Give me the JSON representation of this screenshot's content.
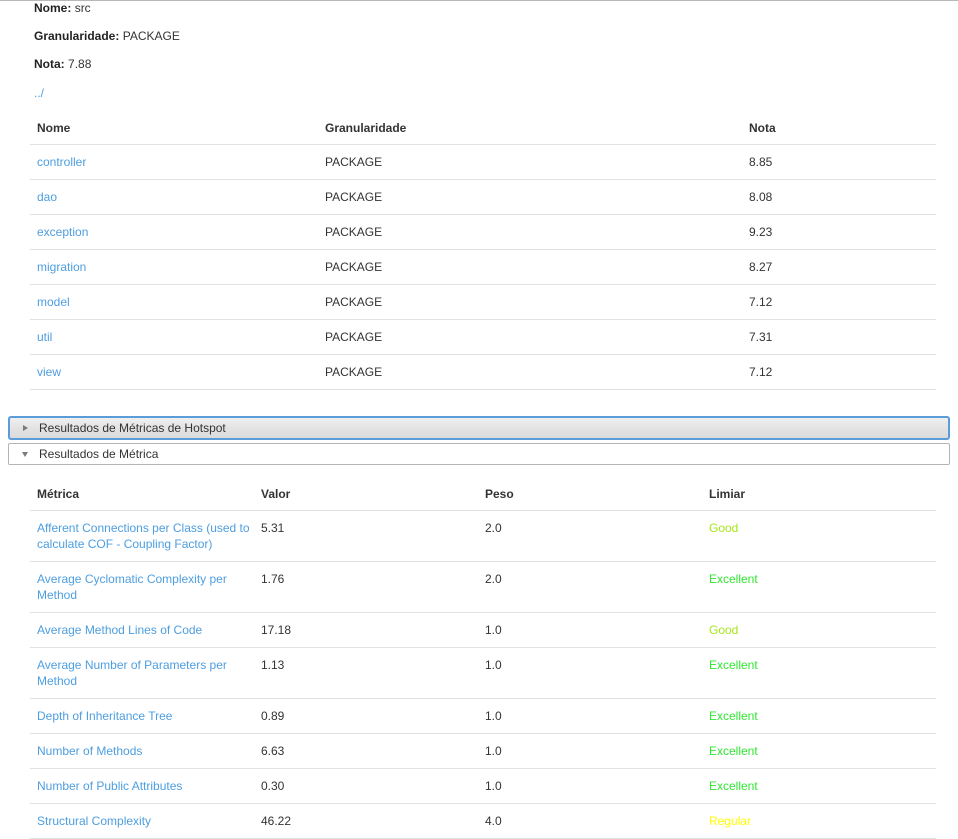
{
  "summary": {
    "nome_label": "Nome:",
    "nome_value": "src",
    "granularidade_label": "Granularidade:",
    "granularidade_value": "PACKAGE",
    "nota_label": "Nota:",
    "nota_value": "7.88",
    "parent_link": "../"
  },
  "files_table": {
    "columns": [
      "Nome",
      "Granularidade",
      "Nota"
    ],
    "rows": [
      {
        "nome": "controller",
        "granularidade": "PACKAGE",
        "nota": "8.85"
      },
      {
        "nome": "dao",
        "granularidade": "PACKAGE",
        "nota": "8.08"
      },
      {
        "nome": "exception",
        "granularidade": "PACKAGE",
        "nota": "9.23"
      },
      {
        "nome": "migration",
        "granularidade": "PACKAGE",
        "nota": "8.27"
      },
      {
        "nome": "model",
        "granularidade": "PACKAGE",
        "nota": "7.12"
      },
      {
        "nome": "util",
        "granularidade": "PACKAGE",
        "nota": "7.31"
      },
      {
        "nome": "view",
        "granularidade": "PACKAGE",
        "nota": "7.12"
      }
    ]
  },
  "accordions": [
    {
      "title": "Resultados de Métricas de Hotspot",
      "state": "collapsed",
      "icon": "triangle-right-icon",
      "focused": true
    },
    {
      "title": "Resultados de Métrica",
      "state": "expanded",
      "icon": "triangle-down-icon",
      "focused": false
    }
  ],
  "metrics_table": {
    "columns": [
      "Métrica",
      "Valor",
      "Peso",
      "Limiar"
    ],
    "rows": [
      {
        "metrica": "Afferent Connections per Class (used to calculate COF - Coupling Factor)",
        "valor": "5.31",
        "peso": "2.0",
        "limiar": "Good",
        "limiar_color": "#a5e619"
      },
      {
        "metrica": "Average Cyclomatic Complexity per Method",
        "valor": "1.76",
        "peso": "2.0",
        "limiar": "Excellent",
        "limiar_color": "#32e632"
      },
      {
        "metrica": "Average Method Lines of Code",
        "valor": "17.18",
        "peso": "1.0",
        "limiar": "Good",
        "limiar_color": "#a5e619"
      },
      {
        "metrica": "Average Number of Parameters per Method",
        "valor": "1.13",
        "peso": "1.0",
        "limiar": "Excellent",
        "limiar_color": "#32e632"
      },
      {
        "metrica": "Depth of Inheritance Tree",
        "valor": "0.89",
        "peso": "1.0",
        "limiar": "Excellent",
        "limiar_color": "#32e632"
      },
      {
        "metrica": "Number of Methods",
        "valor": "6.63",
        "peso": "1.0",
        "limiar": "Excellent",
        "limiar_color": "#32e632"
      },
      {
        "metrica": "Number of Public Attributes",
        "valor": "0.30",
        "peso": "1.0",
        "limiar": "Excellent",
        "limiar_color": "#32e632"
      },
      {
        "metrica": "Structural Complexity",
        "valor": "46.22",
        "peso": "4.0",
        "limiar": "Regular",
        "limiar_color": "#ffff00"
      }
    ]
  },
  "theme": {
    "link_color": "#4d9ee0",
    "focus_border": "#5b9dd9",
    "row_divider": "#e2e2e2"
  }
}
